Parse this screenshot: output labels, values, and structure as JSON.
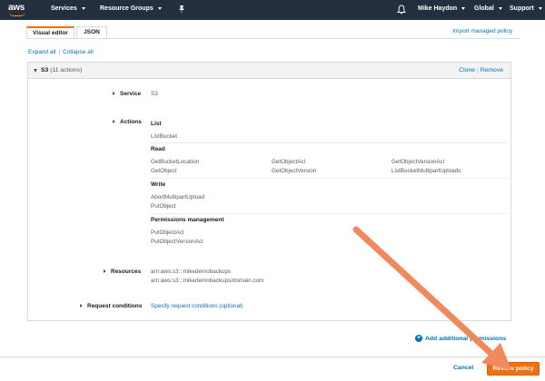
{
  "nav": {
    "logo": "aws",
    "services": "Services",
    "resource_groups": "Resource Groups",
    "user": "Mike Haydon",
    "region": "Global",
    "support": "Support"
  },
  "tabs": [
    {
      "label": "Visual editor",
      "active": true
    },
    {
      "label": "JSON",
      "active": false
    }
  ],
  "import_link": "Import managed policy",
  "expand_all": "Expand all",
  "collapse_all": "Collapse all",
  "panel": {
    "title": "S3",
    "count": "(11 actions)",
    "clone": "Clone",
    "remove": "Remove"
  },
  "service": {
    "label": "Service",
    "value": "S3"
  },
  "actions": {
    "label": "Actions",
    "groups": [
      {
        "title": "List",
        "items": [
          "ListBucket"
        ]
      },
      {
        "title": "Read",
        "items": [
          "GetBucketLocation",
          "GetObjectAcl",
          "GetObjectVersionAcl",
          "GetObject",
          "GetObjectVersion",
          "ListBucketMultipartUploads"
        ]
      },
      {
        "title": "Write",
        "items": [
          "AbortMultipartUpload",
          "PutObject"
        ]
      },
      {
        "title": "Permissions management",
        "items": [
          "PutObjectAcl",
          "PutObjectVersionAcl"
        ]
      }
    ]
  },
  "resources": {
    "label": "Resources",
    "values": [
      "arn:aws:s3:::mikedemobackups",
      "arn:aws:s3:::mikedemobackups/domain.com"
    ]
  },
  "request_conditions": {
    "label": "Request conditions",
    "link": "Specify request conditions (optional)"
  },
  "add_permissions": "Add additional permissions",
  "footer": {
    "cancel": "Cancel",
    "review": "Review policy"
  },
  "colors": {
    "nav_bg": "#232f3e",
    "accent": "#ec7211",
    "link": "#0073bb",
    "annotation_arrow": "#f08a5d"
  },
  "icons": [
    "pin-icon",
    "bell-icon",
    "plus-circle-icon"
  ]
}
